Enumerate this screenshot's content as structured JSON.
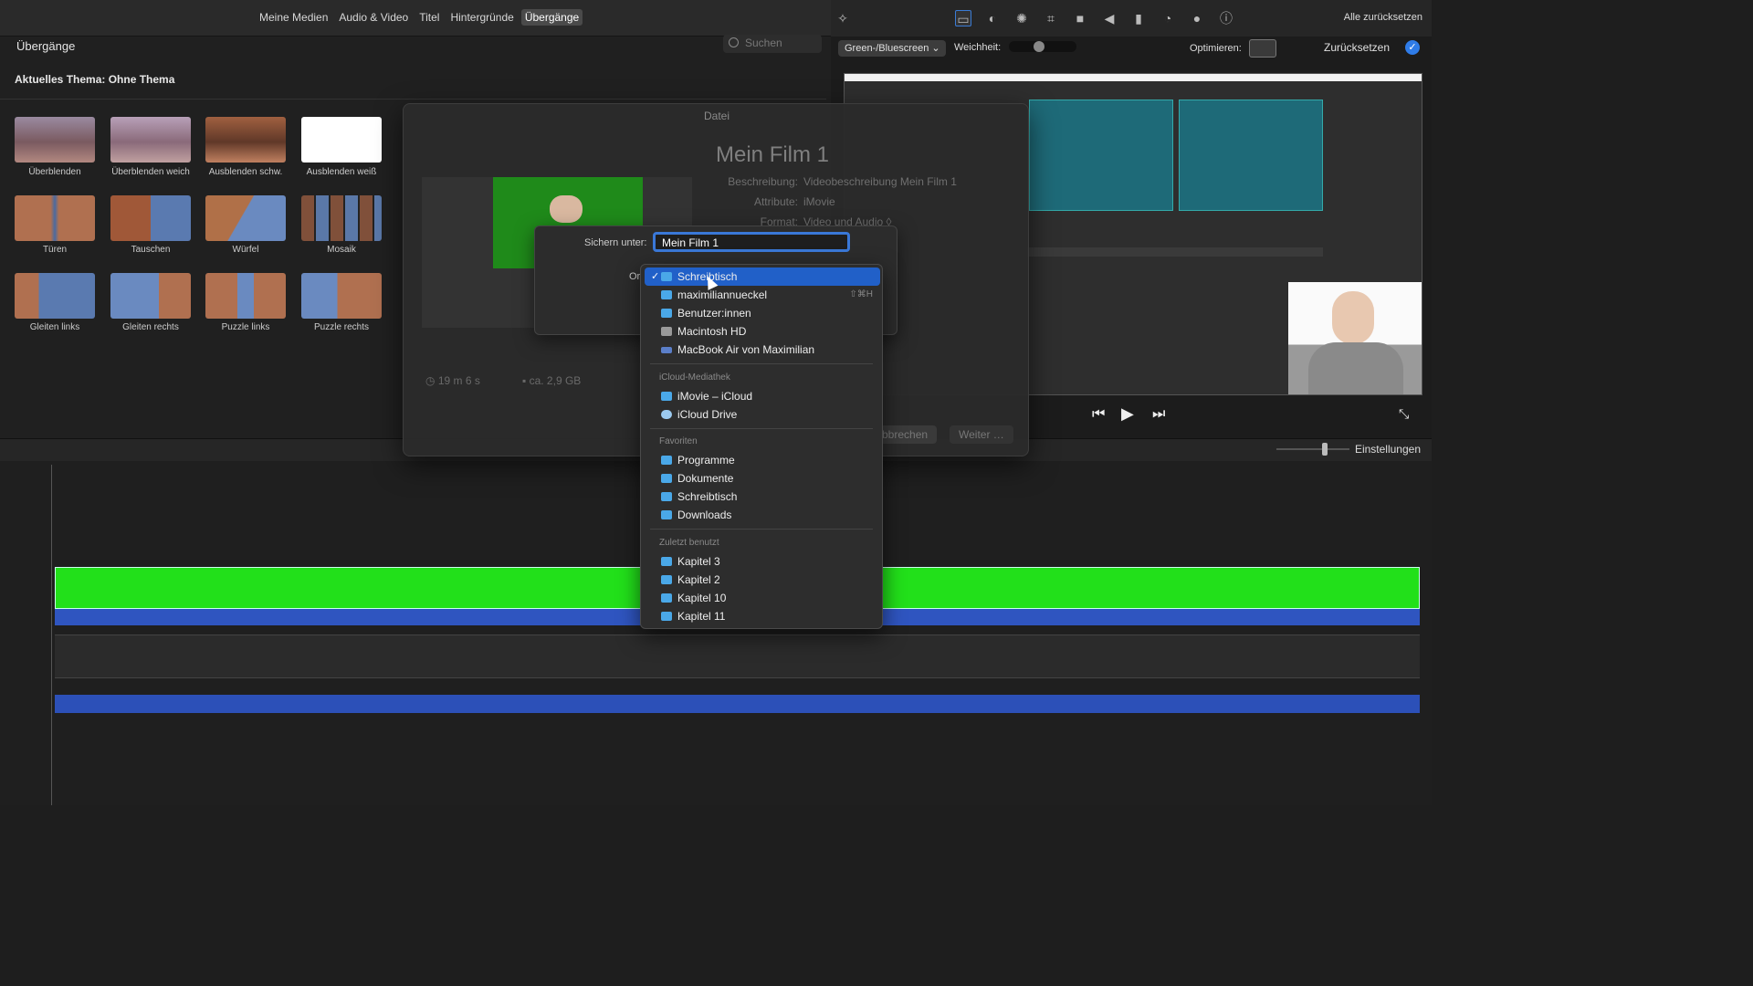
{
  "media_tabs": [
    "Meine Medien",
    "Audio & Video",
    "Titel",
    "Hintergründe",
    "Übergänge"
  ],
  "active_tab": "Übergänge",
  "browser": {
    "title": "Übergänge",
    "search_placeholder": "Suchen",
    "theme_label": "Aktuelles Thema: Ohne Thema",
    "transitions": [
      "Überblenden",
      "Überblenden weich",
      "Ausblenden schw.",
      "Ausblenden weiß",
      "Türen",
      "Tauschen",
      "Würfel",
      "Mosaik",
      "Gleiten links",
      "Gleiten rechts",
      "Puzzle links",
      "Puzzle rechts"
    ]
  },
  "toolbar": {
    "reset_all": "Alle zurücksetzen",
    "icons": [
      "magic-wand-icon",
      "crop-frame-icon",
      "color-balance-icon",
      "palette-icon",
      "crop-icon",
      "camera-icon",
      "volume-icon",
      "equalizer-icon",
      "speed-icon",
      "filter-icon",
      "info-icon"
    ]
  },
  "viewer": {
    "effect_select": "Green-/Bluescreen",
    "weichheit_label": "Weichheit:",
    "optimieren_label": "Optimieren:",
    "zuruecksetzen": "Zurücksetzen"
  },
  "timeline": {
    "einstellungen": "Einstellungen"
  },
  "export_sheet": {
    "title": "Datei",
    "film_title": "Mein Film 1",
    "info": [
      {
        "label": "Beschreibung:",
        "value": "Videobeschreibung Mein Film 1"
      },
      {
        "label": "Attribute:",
        "value": "iMovie"
      },
      {
        "label": "Format:",
        "value": "Video und Audio ◊"
      }
    ],
    "duration": "19 m 6 s",
    "size": "ca. 2,9 GB",
    "cancel_label": "Abbrechen",
    "next_label": "Weiter …"
  },
  "save_dialog": {
    "save_as_label": "Sichern unter:",
    "filename": "Mein Film 1",
    "location_label": "Ort"
  },
  "location_menu": {
    "items": [
      {
        "label": "Schreibtisch",
        "selected": true,
        "icon": "folder-icon"
      },
      {
        "label": "maximiliannueckel",
        "icon": "folder-icon",
        "shortcut": "⇧⌘H"
      },
      {
        "label": "Benutzer:innen",
        "icon": "folder-icon"
      },
      {
        "label": "Macintosh HD",
        "icon": "drive-icon"
      },
      {
        "label": "MacBook Air von Maximilian",
        "icon": "laptop-icon"
      }
    ],
    "icloud_header": "iCloud-Mediathek",
    "icloud_items": [
      {
        "label": "iMovie – iCloud",
        "icon": "folder-icon"
      },
      {
        "label": "iCloud Drive",
        "icon": "cloud-icon"
      }
    ],
    "favorites_header": "Favoriten",
    "favorites": [
      "Programme",
      "Dokumente",
      "Schreibtisch",
      "Downloads"
    ],
    "recent_header": "Zuletzt benutzt",
    "recent": [
      "Kapitel 3",
      "Kapitel 2",
      "Kapitel 10",
      "Kapitel 11"
    ]
  }
}
